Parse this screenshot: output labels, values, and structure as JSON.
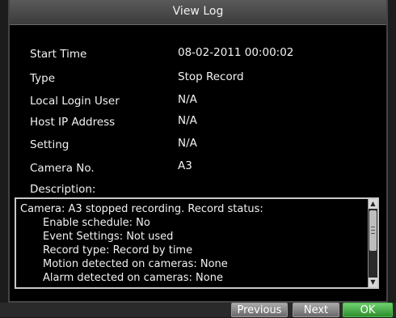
{
  "dialog": {
    "title": "View Log"
  },
  "fields": [
    {
      "label": "Start Time",
      "value": "08-02-2011 00:00:02"
    },
    {
      "label": "Type",
      "value": "Stop Record"
    },
    {
      "label": "Local Login User",
      "value": "N/A"
    },
    {
      "label": "Host IP Address",
      "value": "N/A"
    },
    {
      "label": "Setting",
      "value": "N/A"
    },
    {
      "label": "Camera No.",
      "value": "A3"
    }
  ],
  "description": {
    "label": "Description:",
    "lines": [
      "Camera: A3 stopped recording. Record status:",
      "Enable schedule: No",
      "Event Settings: Not used",
      "Record type: Record by time",
      "Motion detected on cameras: None",
      "Alarm detected on cameras: None"
    ]
  },
  "buttons": {
    "previous": "Previous",
    "next": "Next",
    "ok": "OK"
  },
  "colors": {
    "background": "#000000",
    "title_bar": "#4a4a4a",
    "text": "#f2f2f2",
    "ok_button": "#3fae3f"
  }
}
